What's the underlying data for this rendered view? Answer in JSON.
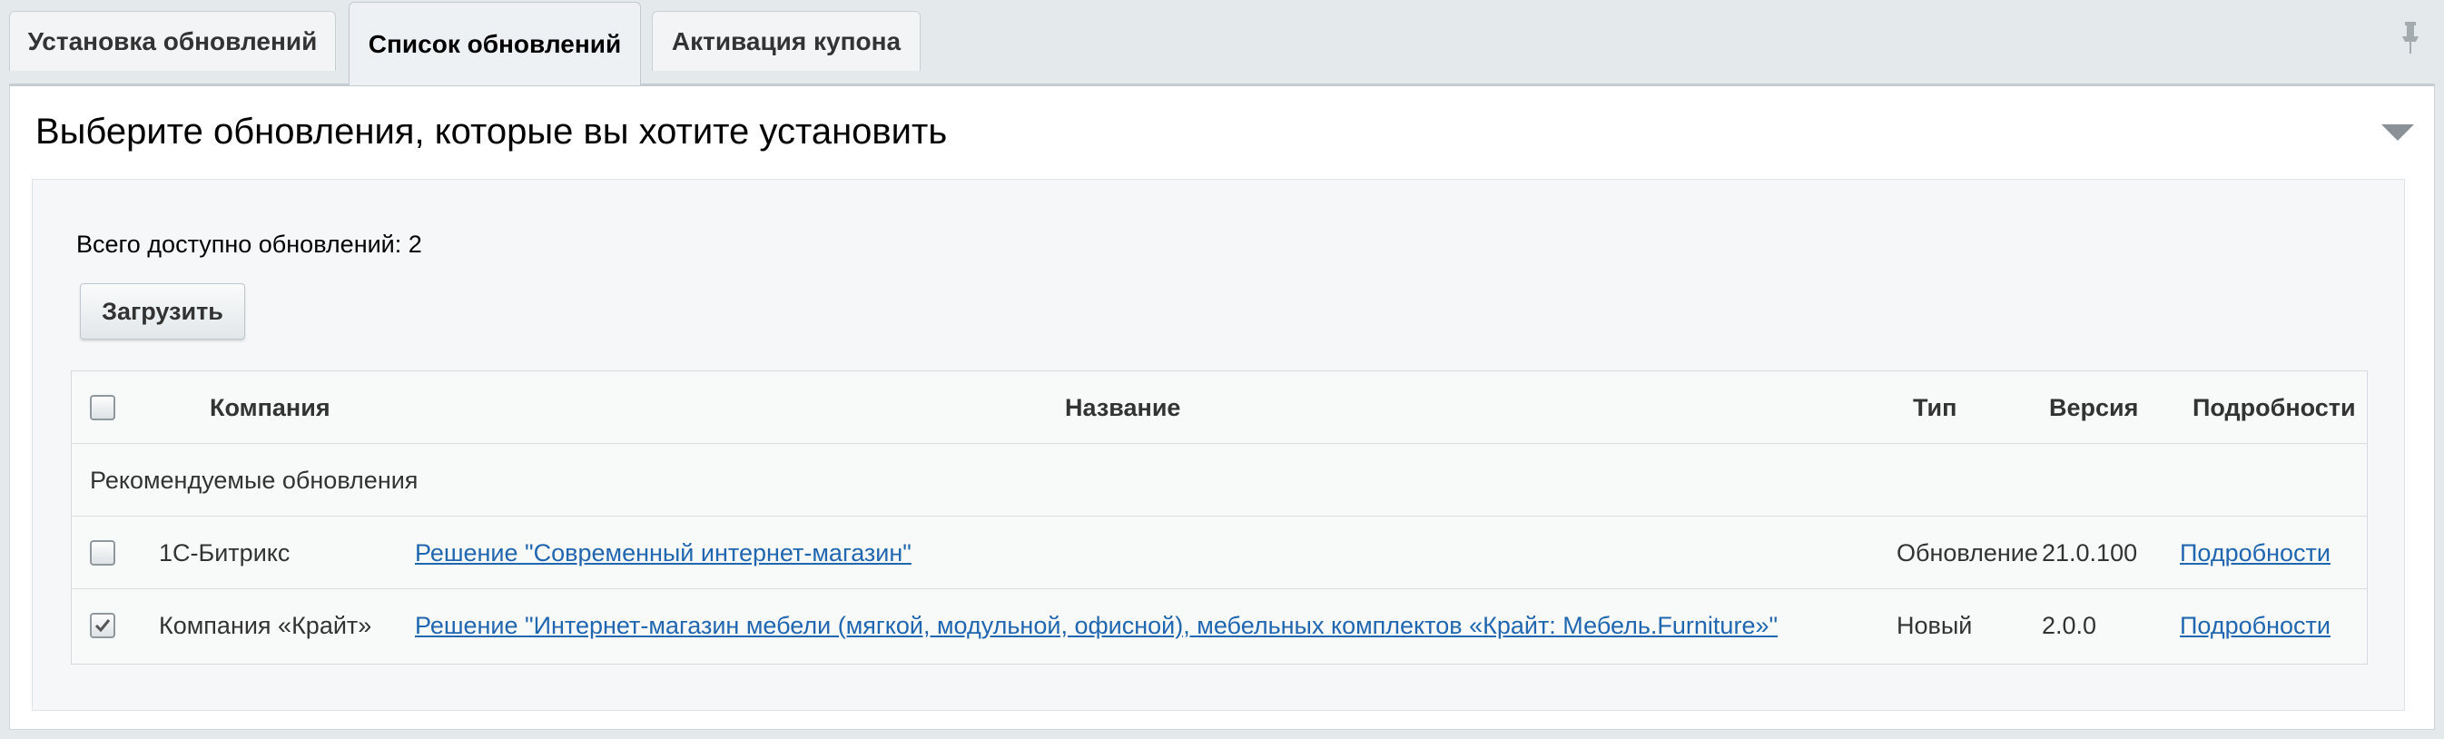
{
  "tabs": [
    {
      "label": "Установка обновлений",
      "active": false
    },
    {
      "label": "Список обновлений",
      "active": true
    },
    {
      "label": "Активация купона",
      "active": false
    }
  ],
  "panel": {
    "title": "Выберите обновления, которые вы хотите установить",
    "count_text": "Всего доступно обновлений: 2",
    "load_button": "Загрузить"
  },
  "table": {
    "headers": {
      "company": "Компания",
      "name": "Название",
      "type": "Тип",
      "version": "Версия",
      "details": "Подробности"
    },
    "group_label": "Рекомендуемые обновления",
    "rows": [
      {
        "checked": false,
        "company": "1С-Битрикс",
        "name": "Решение \"Современный интернет-магазин\"",
        "type": "Обновление",
        "version": "21.0.100",
        "details": "Подробности"
      },
      {
        "checked": true,
        "company": "Компания «Крайт»",
        "name": "Решение \"Интернет-магазин мебели (мягкой, модульной, офисной), мебельных комплектов «Крайт: Мебель.Furniture»\"",
        "type": "Новый",
        "version": "2.0.0",
        "details": "Подробности"
      }
    ]
  },
  "icons": {
    "pin": "pin-icon",
    "collapse": "triangle-down-icon",
    "check": "check-icon"
  },
  "colors": {
    "link": "#2067b0",
    "background": "#e4e9ec",
    "panel": "#ffffff"
  }
}
